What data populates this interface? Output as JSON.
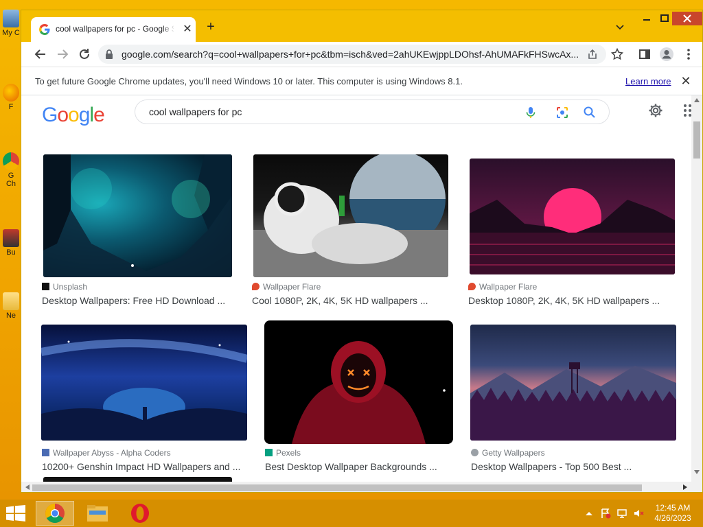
{
  "desktop": {
    "icons": [
      {
        "label": "My C"
      },
      {
        "label": "F"
      },
      {
        "label": "G"
      },
      {
        "label": "Ch"
      },
      {
        "label": "Bu"
      },
      {
        "label": "Ne"
      }
    ]
  },
  "browser": {
    "tab_title": "cool wallpapers for pc - Google S",
    "url": "google.com/search?q=cool+wallpapers+for+pc&tbm=isch&ved=2ahUKEwjppLDOhsf-AhUMAFkFHSwcAx...",
    "infobar_text": "To get future Google Chrome updates, you'll need Windows 10 or later. This computer is using Windows 8.1.",
    "infobar_link": "Learn more"
  },
  "google": {
    "query": "cool wallpapers for pc",
    "logo_letters": [
      "G",
      "o",
      "o",
      "g",
      "l",
      "e"
    ],
    "logo_colors": [
      "#4285f4",
      "#ea4335",
      "#fbbc05",
      "#4285f4",
      "#34a853",
      "#ea4335"
    ]
  },
  "results": [
    {
      "source": "Unsplash",
      "title": "Desktop Wallpapers: Free HD Download ..."
    },
    {
      "source": "Wallpaper Flare",
      "title": "Cool 1080P, 2K, 4K, 5K HD wallpapers ..."
    },
    {
      "source": "Wallpaper Flare",
      "title": "Desktop 1080P, 2K, 4K, 5K HD wallpapers ..."
    },
    {
      "source": "Wallpaper Abyss - Alpha Coders",
      "title": "10200+ Genshin Impact HD Wallpapers and ..."
    },
    {
      "source": "Pexels",
      "title": "Best Desktop Wallpaper Backgrounds ..."
    },
    {
      "source": "Getty Wallpapers",
      "title": "Desktop Wallpapers - Top 500 Best ..."
    }
  ],
  "taskbar": {
    "time": "12:45 AM",
    "date": "4/26/2023"
  },
  "colors": {
    "accent_blue": "#1a73e8",
    "titlebar": "#f4be00",
    "desktop": "#f0a500"
  }
}
